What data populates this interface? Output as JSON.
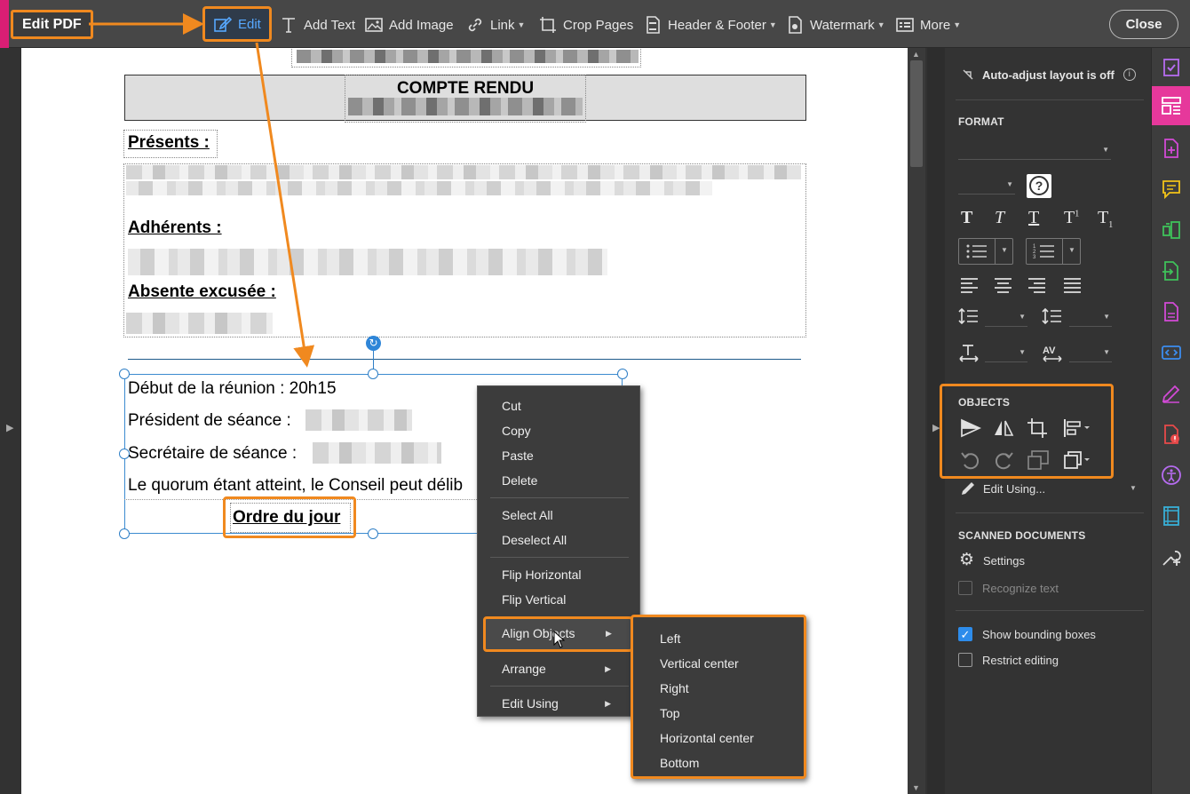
{
  "app": {
    "title": "Edit PDF",
    "close_label": "Close"
  },
  "toolbar": {
    "tools": [
      {
        "label": "Edit"
      },
      {
        "label": "Add Text"
      },
      {
        "label": "Add Image"
      },
      {
        "label": "Link"
      },
      {
        "label": "Crop Pages"
      },
      {
        "label": "Header & Footer"
      },
      {
        "label": "Watermark"
      },
      {
        "label": "More"
      }
    ]
  },
  "document": {
    "title": "COMPTE RENDU",
    "headings": {
      "presents": "Présents :",
      "adherents": "Adhérents :",
      "absente": "Absente excusée :"
    },
    "lines": {
      "debut": "Début de la réunion : 20h15",
      "president": "Président de séance :",
      "secretaire": "Secrétaire de séance :",
      "quorum": "Le quorum étant atteint, le Conseil peut délib"
    },
    "ordre": "Ordre du jour"
  },
  "context_menu": {
    "items": [
      "Cut",
      "Copy",
      "Paste",
      "Delete",
      "Select All",
      "Deselect All",
      "Flip Horizontal",
      "Flip Vertical",
      "Align Objects",
      "Arrange",
      "Edit Using"
    ]
  },
  "align_submenu": {
    "items": [
      "Left",
      "Vertical center",
      "Right",
      "Top",
      "Horizontal center",
      "Bottom"
    ]
  },
  "right_panel": {
    "auto_adjust": "Auto-adjust layout is off",
    "format_label": "FORMAT",
    "objects_label": "OBJECTS",
    "edit_using": "Edit Using...",
    "scanned_label": "SCANNED DOCUMENTS",
    "settings": "Settings",
    "recognize_text": "Recognize text",
    "show_bounding_boxes": "Show bounding boxes",
    "show_bounding_boxes_checked": true,
    "restrict_editing": "Restrict editing",
    "restrict_editing_checked": false
  },
  "colors": {
    "accent_orange": "#f0891f",
    "selection_blue": "#3c8bd0",
    "active_pink": "#e6389b"
  }
}
